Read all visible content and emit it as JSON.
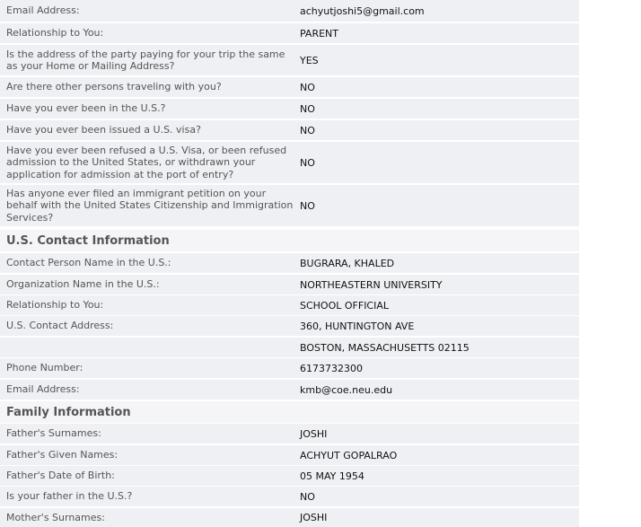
{
  "rows_top": [
    {
      "label": "Email Address:",
      "value": "achyutjoshi5@gmail.com"
    },
    {
      "label": "Relationship to You:",
      "value": "PARENT"
    },
    {
      "label": "Is the address of the party paying for your trip the same as your Home or Mailing Address?",
      "value": "YES"
    },
    {
      "label": "Are there other persons traveling with you?",
      "value": "NO"
    },
    {
      "label": "Have you ever been in the U.S.?",
      "value": "NO"
    },
    {
      "label": "Have you ever been issued a U.S. visa?",
      "value": "NO"
    },
    {
      "label": "Have you ever been refused a U.S. Visa, or been refused admission to the United States, or withdrawn your application for admission at the port of entry?",
      "value": "NO"
    },
    {
      "label": "Has anyone ever filed an immigrant petition on your behalf with the United States Citizenship and Immigration Services?",
      "value": "NO"
    }
  ],
  "us_contact": {
    "heading": "U.S. Contact Information",
    "rows": [
      {
        "label": "Contact Person Name in the U.S.:",
        "value": "BUGRARA, KHALED"
      },
      {
        "label": "Organization Name in the U.S.:",
        "value": "NORTHEASTERN UNIVERSITY"
      },
      {
        "label": "Relationship to You:",
        "value": "SCHOOL OFFICIAL"
      },
      {
        "label": "U.S. Contact Address:",
        "value": "360, HUNTINGTON AVE"
      },
      {
        "label": "",
        "value": "BOSTON, MASSACHUSETTS 02115"
      },
      {
        "label": "Phone Number:",
        "value": "6173732300"
      },
      {
        "label": "Email Address:",
        "value": "kmb@coe.neu.edu"
      }
    ]
  },
  "family": {
    "heading": "Family Information",
    "rows": [
      {
        "label": "Father's Surnames:",
        "value": "JOSHI"
      },
      {
        "label": "Father's Given Names:",
        "value": "ACHYUT GOPALRAO"
      },
      {
        "label": "Father's Date of Birth:",
        "value": "05 MAY 1954"
      },
      {
        "label": "Is your father in the U.S.?",
        "value": "NO"
      },
      {
        "label": "Mother's Surnames:",
        "value": "JOSHI"
      }
    ]
  }
}
